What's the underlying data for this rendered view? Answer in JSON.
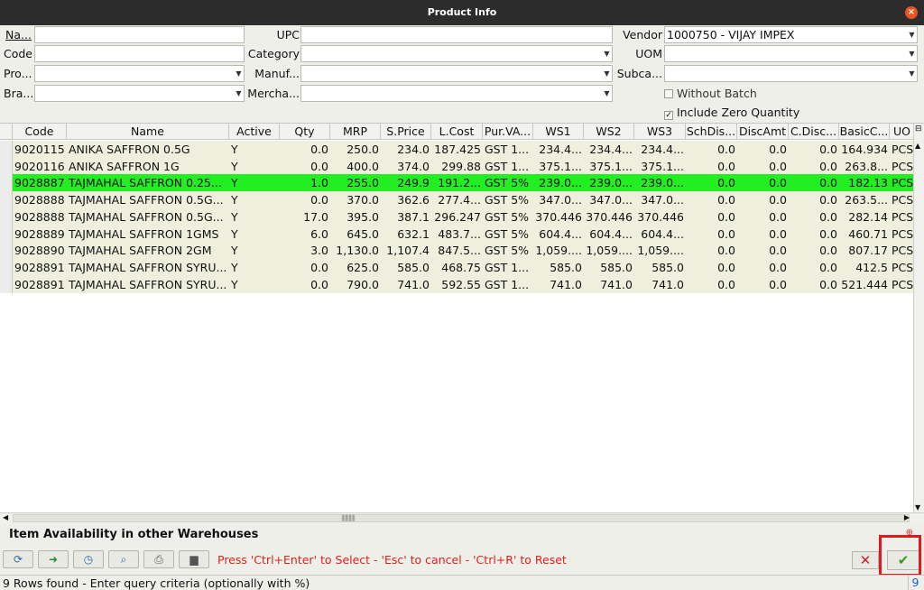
{
  "window": {
    "title": "Product Info",
    "close_icon": "×"
  },
  "form": {
    "name_label": "Na...",
    "code_label": "Code",
    "product_label": "Pro...",
    "brand_label": "Bra...",
    "upc_label": "UPC",
    "category_label": "Category",
    "manufacturer_label": "Manuf...",
    "merchandise_label": "Mercha...",
    "vendor_label": "Vendor",
    "vendor_value": "1000750 - VIJAY IMPEX",
    "uom_label": "UOM",
    "subcategory_label": "Subca...",
    "without_batch_label": "Without Batch",
    "without_batch_checked": false,
    "include_zero_label": "Include Zero Quantity",
    "include_zero_checked": true
  },
  "table": {
    "columns": [
      "Code",
      "Name",
      "Active",
      "Qty",
      "MRP",
      "S.Price",
      "L.Cost",
      "Pur.VA...",
      "WS1",
      "WS2",
      "WS3",
      "SchDis...",
      "DiscAmt",
      "C.Disc...",
      "BasicC...",
      "UO"
    ],
    "rows": [
      [
        "9020115",
        "ANIKA SAFFRON 0.5G",
        "Y",
        "0.0",
        "250.0",
        "234.0",
        "187.425",
        "GST 1...",
        "234.4...",
        "234.4...",
        "234.4...",
        "0.0",
        "0.0",
        "0.0",
        "164.934",
        "PCS"
      ],
      [
        "9020116",
        "ANIKA SAFFRON 1G",
        "Y",
        "0.0",
        "400.0",
        "374.0",
        "299.88",
        "GST 1...",
        "375.1...",
        "375.1...",
        "375.1...",
        "0.0",
        "0.0",
        "0.0",
        "263.8...",
        "PCS"
      ],
      [
        "9028887",
        "TAJMAHAL SAFFRON 0.25...",
        "Y",
        "1.0",
        "255.0",
        "249.9",
        "191.2...",
        "GST 5%",
        "239.0...",
        "239.0...",
        "239.0...",
        "0.0",
        "0.0",
        "0.0",
        "182.13",
        "PCS"
      ],
      [
        "9028888",
        "TAJMAHAL SAFFRON 0.5G...",
        "Y",
        "0.0",
        "370.0",
        "362.6",
        "277.4...",
        "GST 5%",
        "347.0...",
        "347.0...",
        "347.0...",
        "0.0",
        "0.0",
        "0.0",
        "263.5...",
        "PCS"
      ],
      [
        "9028888",
        "TAJMAHAL SAFFRON 0.5G...",
        "Y",
        "17.0",
        "395.0",
        "387.1",
        "296.247",
        "GST 5%",
        "370.446",
        "370.446",
        "370.446",
        "0.0",
        "0.0",
        "0.0",
        "282.14",
        "PCS"
      ],
      [
        "9028889",
        "TAJMAHAL SAFFRON 1GMS",
        "Y",
        "6.0",
        "645.0",
        "632.1",
        "483.7...",
        "GST 5%",
        "604.4...",
        "604.4...",
        "604.4...",
        "0.0",
        "0.0",
        "0.0",
        "460.71",
        "PCS"
      ],
      [
        "9028890",
        "TAJMAHAL SAFFRON 2GM",
        "Y",
        "3.0",
        "1,130.0",
        "1,107.4",
        "847.5...",
        "GST 5%",
        "1,059....",
        "1,059....",
        "1,059....",
        "0.0",
        "0.0",
        "0.0",
        "807.17",
        "PCS"
      ],
      [
        "9028891",
        "TAJMAHAL SAFFRON SYRU...",
        "Y",
        "0.0",
        "625.0",
        "585.0",
        "468.75",
        "GST 1...",
        "585.0",
        "585.0",
        "585.0",
        "0.0",
        "0.0",
        "0.0",
        "412.5",
        "PCS"
      ],
      [
        "9028891",
        "TAJMAHAL SAFFRON SYRU...",
        "Y",
        "0.0",
        "790.0",
        "741.0",
        "592.55",
        "GST 1...",
        "741.0",
        "741.0",
        "741.0",
        "0.0",
        "0.0",
        "0.0",
        "521.444",
        "PCS"
      ]
    ],
    "selected_row": 2,
    "selected_color": "#22ee22"
  },
  "bottom": {
    "section_title": "Item Availability in other Warehouses",
    "hint": "Press 'Ctrl+Enter' to Select - 'Esc' to cancel - 'Ctrl+R' to Reset",
    "status_text": "9 Rows found - Enter query criteria (optionally with %)",
    "row_count": "9"
  }
}
